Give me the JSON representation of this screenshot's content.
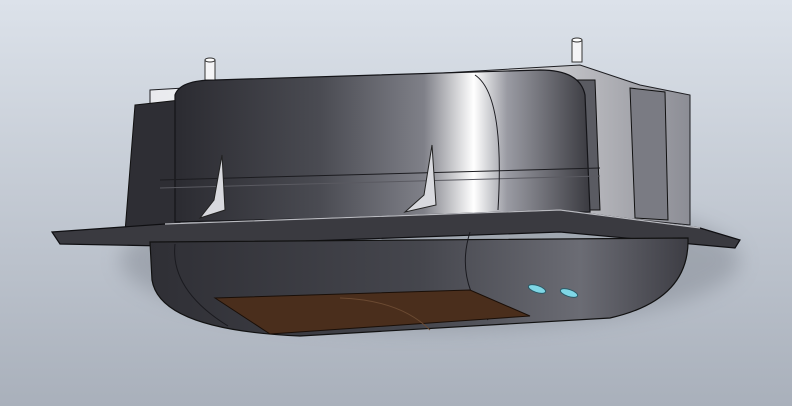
{
  "scene": {
    "background_top": "#dce2ea",
    "background_bottom": "#a9b0bb",
    "body_light": "#ffffff",
    "body_mid": "#7f8088",
    "body_dark": "#2b2b31",
    "flange_color": "#3a3a40",
    "window_color": "#4a2e1c",
    "indicator_color": "#7fd7e6"
  }
}
